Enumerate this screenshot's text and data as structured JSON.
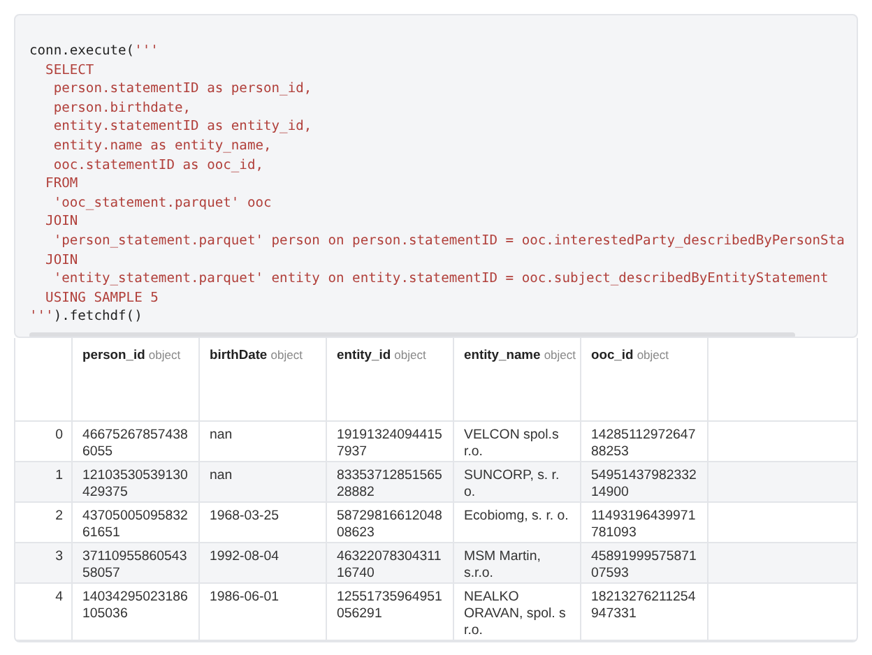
{
  "code": {
    "lines": [
      [
        {
          "kind": "plain",
          "text": "conn.execute("
        },
        {
          "kind": "string",
          "text": "'''"
        }
      ],
      [
        {
          "kind": "string",
          "text": "  SELECT"
        }
      ],
      [
        {
          "kind": "string",
          "text": "   person.statementID as person_id,"
        }
      ],
      [
        {
          "kind": "string",
          "text": "   person.birthdate,"
        }
      ],
      [
        {
          "kind": "string",
          "text": "   entity.statementID as entity_id,"
        }
      ],
      [
        {
          "kind": "string",
          "text": "   entity.name as entity_name,"
        }
      ],
      [
        {
          "kind": "string",
          "text": "   ooc.statementID as ooc_id,"
        }
      ],
      [
        {
          "kind": "string",
          "text": "  FROM"
        }
      ],
      [
        {
          "kind": "string",
          "text": "   'ooc_statement.parquet' ooc"
        }
      ],
      [
        {
          "kind": "string",
          "text": "  JOIN"
        }
      ],
      [
        {
          "kind": "string",
          "text": "   'person_statement.parquet' person on person.statementID = ooc.interestedParty_describedByPersonSta"
        }
      ],
      [
        {
          "kind": "string",
          "text": "  JOIN"
        }
      ],
      [
        {
          "kind": "string",
          "text": "   'entity_statement.parquet' entity on entity.statementID = ooc.subject_describedByEntityStatement"
        }
      ],
      [
        {
          "kind": "string",
          "text": "  USING SAMPLE 5"
        }
      ],
      [
        {
          "kind": "string",
          "text": "'''"
        },
        {
          "kind": "plain",
          "text": ").fetchdf()"
        }
      ]
    ]
  },
  "table": {
    "columns": [
      {
        "name": "person_id",
        "dtype": "object"
      },
      {
        "name": "birthDate",
        "dtype": "object"
      },
      {
        "name": "entity_id",
        "dtype": "object"
      },
      {
        "name": "entity_name",
        "dtype": "object"
      },
      {
        "name": "ooc_id",
        "dtype": "object"
      }
    ],
    "rows": [
      {
        "index": "0",
        "cells": [
          "466752678574386055",
          "nan",
          "191913240944157937",
          "VELCON spol.s r.o.",
          "1428511297264788253"
        ]
      },
      {
        "index": "1",
        "cells": [
          "12103530539130429375",
          "nan",
          "8335371285156528882",
          "SUNCORP, s. r. o.",
          "5495143798233214900"
        ]
      },
      {
        "index": "2",
        "cells": [
          "4370500509583261651",
          "1968-03-25",
          "5872981661204808623",
          "Ecobiomg, s. r. o.",
          "11493196439971781093"
        ]
      },
      {
        "index": "3",
        "cells": [
          "3711095586054358057",
          "1992-08-04",
          "4632207830431116740",
          "MSM Martin, s.r.o.",
          "4589199957587107593"
        ]
      },
      {
        "index": "4",
        "cells": [
          "14034295023186105036",
          "1986-06-01",
          "12551735964951056291",
          "NEALKO ORAVAN, spol. s r.o.",
          "18213276211254947331"
        ]
      }
    ]
  }
}
